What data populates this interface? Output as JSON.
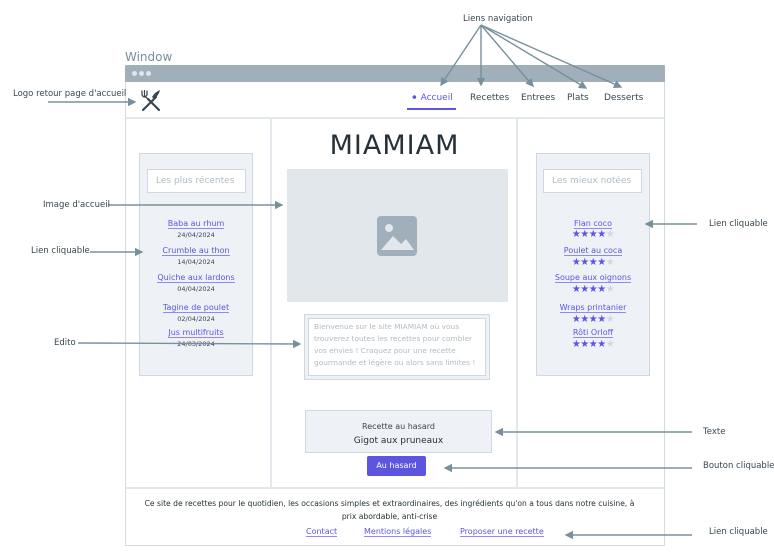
{
  "annotations": {
    "nav_links": "Liens navigation",
    "logo": "Logo retour page d'accueil",
    "hero_image": "Image d'accueil",
    "clickable_left": "Lien cliquable",
    "edito": "Edito",
    "clickable_right": "Lien cliquable",
    "text": "Texte",
    "button": "Bouton cliquable",
    "clickable_footer": "Lien cliquable"
  },
  "window": {
    "label": "Window"
  },
  "header": {
    "logo_icon": "fork-knife-icon",
    "nav": [
      {
        "label": "Accueil",
        "icon": "home-icon",
        "active": true
      },
      {
        "label": "Recettes"
      },
      {
        "label": "Entrees"
      },
      {
        "label": "Plats"
      },
      {
        "label": "Desserts"
      }
    ]
  },
  "left_sidebar": {
    "placeholder": "Les plus récentes",
    "items": [
      {
        "title": "Baba au rhum",
        "date": "24/04/2024"
      },
      {
        "title": "Crumble au thon",
        "date": "14/04/2024"
      },
      {
        "title": "Quiche aux lardons",
        "date": "04/04/2024"
      },
      {
        "title": "Tagine de poulet",
        "date": "02/04/2024"
      },
      {
        "title": "Jus multifruits",
        "date": "24/03/2024"
      }
    ]
  },
  "right_sidebar": {
    "placeholder": "Les mieux notées",
    "items": [
      {
        "title": "Flan coco",
        "rating": 4,
        "max": 5
      },
      {
        "title": "Poulet au coca",
        "rating": 4,
        "max": 5
      },
      {
        "title": "Soupe aux oignons",
        "rating": 4,
        "max": 5
      },
      {
        "title": "Wraps printanier",
        "rating": 4,
        "max": 5
      },
      {
        "title": "Rôti Orloff",
        "rating": 4,
        "max": 5
      }
    ]
  },
  "main": {
    "title": "MIAMIAM",
    "hero_icon": "image-placeholder-icon",
    "edito": "Bienvenue sur le site MIAMIAM où vous trouverez toutes les recettes pour combler vos envies ! Craquez pour une recette gourmande et légère ou alors sans limites !",
    "random_label": "Recette au hasard",
    "random_value": "Gigot aux pruneaux",
    "random_button": "Au hasard"
  },
  "footer": {
    "text": "Ce site de recettes pour le quotidien, les occasions simples et extraordinaires, des ingrédients qu'on a tous dans notre cuisine, à prix abordable, anti-crise",
    "links": [
      "Contact",
      "Mentions légales",
      "Proposer une recette"
    ]
  },
  "colors": {
    "accent": "#5b55e0",
    "titlebar": "#a1afbb",
    "panel": "#eef2f6",
    "image": "#e2e7ec",
    "arrow": "#78909c"
  }
}
